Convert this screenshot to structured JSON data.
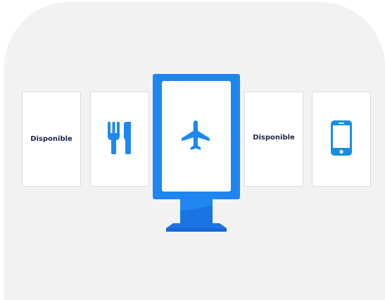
{
  "cards": [
    {
      "label": "Disponible"
    },
    {
      "icon": "fork-knife-icon"
    },
    {
      "icon": "airplane-icon"
    },
    {
      "label": "Disponible"
    },
    {
      "icon": "smartphone-icon"
    }
  ],
  "colors": {
    "kiosk_blue": "#1f86f0",
    "kiosk_stand": "#1a74e3",
    "icon_blue": "#1e88f0",
    "phone_icon": "#1590df",
    "label_text": "#1d2547",
    "panel_bg": "#f2f2f2"
  }
}
